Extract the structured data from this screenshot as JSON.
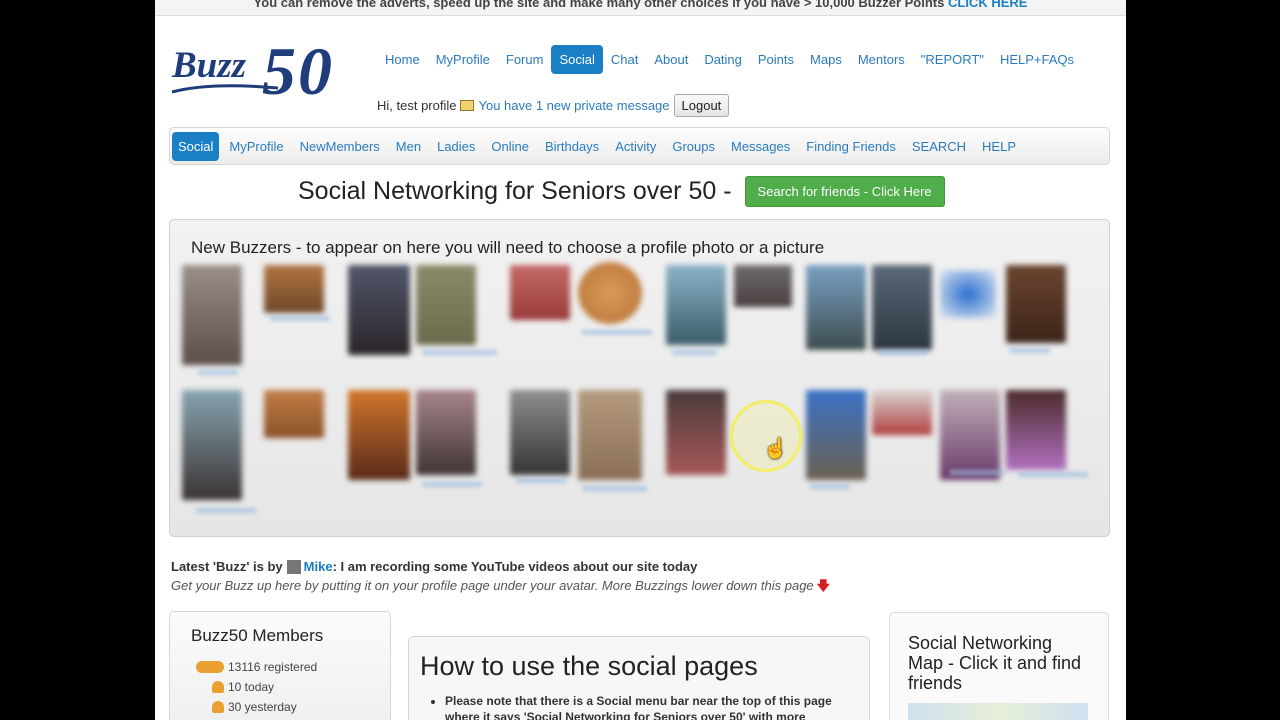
{
  "banner": {
    "text": "You can remove the adverts, speed up the site and make many other choices if you have > 10,000 Buzzer Points",
    "link": "CLICK HERE"
  },
  "logo": {
    "buzz": "Buzz",
    "fifty": "50"
  },
  "main_nav": [
    "Home",
    "MyProfile",
    "Forum",
    "Social",
    "Chat",
    "About",
    "Dating",
    "Points",
    "Maps",
    "Mentors",
    "\"REPORT\"",
    "HELP+FAQs"
  ],
  "user": {
    "greeting": "Hi, test profile",
    "message_link": "You have 1 new private message",
    "logout": "Logout"
  },
  "sub_nav": [
    "Social",
    "MyProfile",
    "NewMembers",
    "Men",
    "Ladies",
    "Online",
    "Birthdays",
    "Activity",
    "Groups",
    "Messages",
    "Finding Friends",
    "SEARCH",
    "HELP"
  ],
  "headline": {
    "title": "Social Networking for Seniors over 50 -",
    "button": "Search for friends - Click Here"
  },
  "buzzers": {
    "heading": "New Buzzers - to appear on here you will need to choose a profile photo or a picture"
  },
  "latest_buzz": {
    "prefix": "Latest 'Buzz' is by",
    "name": "Mike",
    "text": ": I am recording some YouTube videos about our site today",
    "hint": "Get your Buzz up here by putting it on your profile page under your avatar. More Buzzings lower down this page"
  },
  "members": {
    "title": "Buzz50 Members",
    "registered": "13116 registered",
    "today": "10 today",
    "yesterday": "30 yesterday"
  },
  "howto": {
    "title": "How to use the social pages",
    "bullet": "Please note that there is a Social menu bar near the top of this page where it says 'Social Networking for Seniors over 50' with more"
  },
  "map": {
    "title": "Social Networking Map - Click it and find friends"
  },
  "colors": {
    "accent": "#1a7fc4",
    "green_button": "#4fad4a",
    "logo": "#1f3d7a"
  }
}
